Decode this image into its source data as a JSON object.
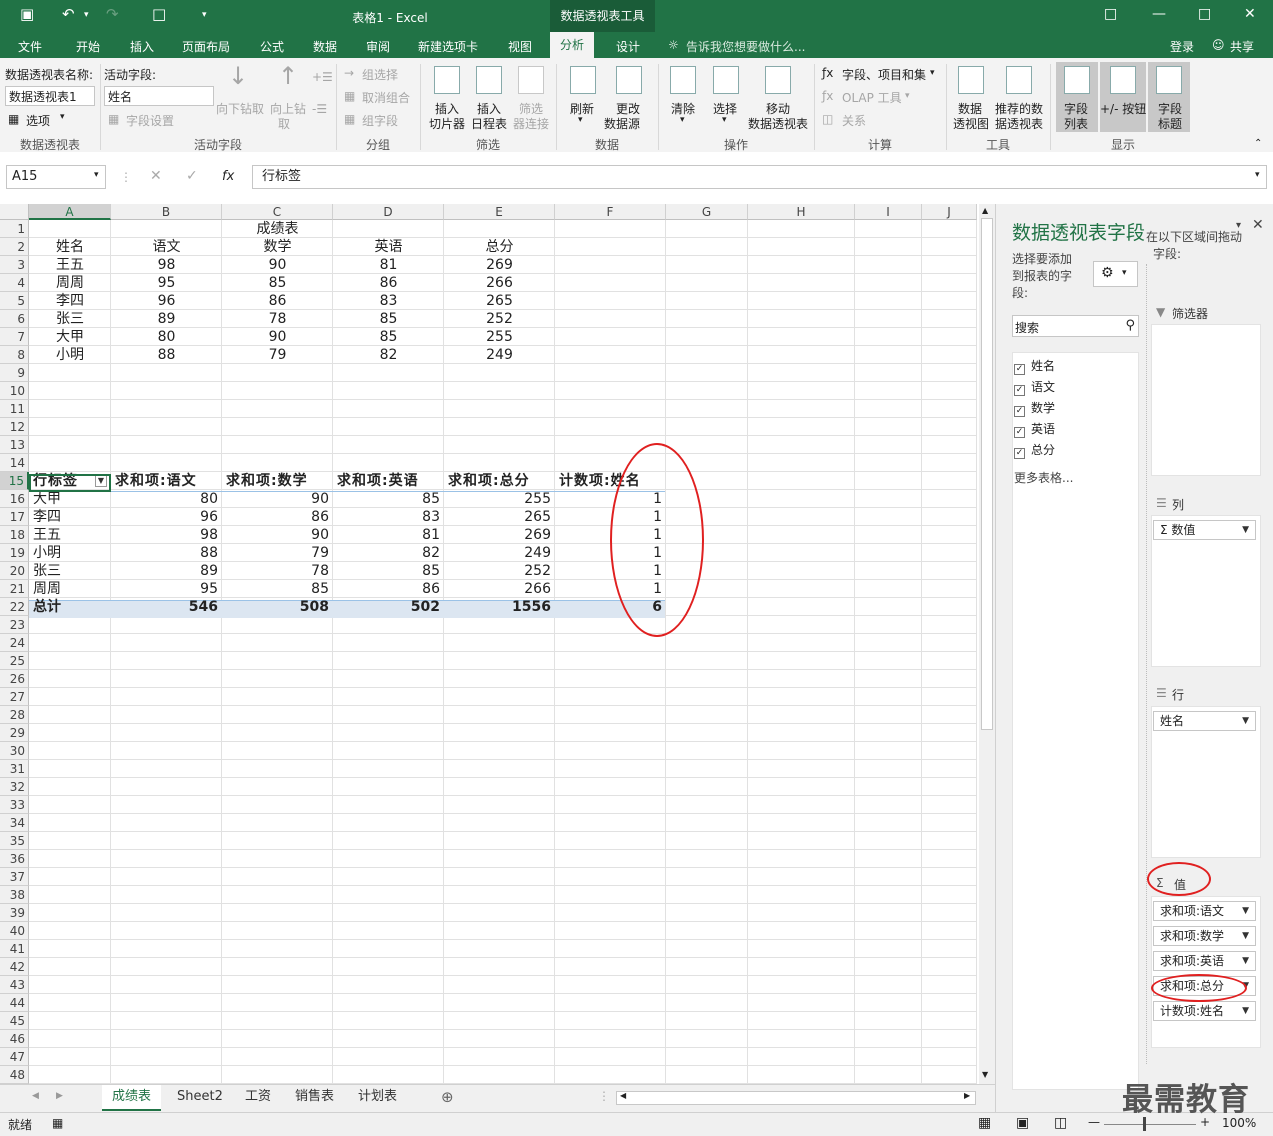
{
  "window": {
    "title": "表格1 - Excel",
    "context_tab": "数据透视表工具",
    "login": "登录",
    "share": "共享",
    "tell_me": "告诉我您想要做什么..."
  },
  "tabs": [
    "文件",
    "开始",
    "插入",
    "页面布局",
    "公式",
    "数据",
    "审阅",
    "新建选项卡",
    "视图",
    "分析",
    "设计"
  ],
  "active_tab": "分析",
  "ribbon": {
    "pt_name_label": "数据透视表名称:",
    "pt_name_value": "数据透视表1",
    "options": "选项",
    "group_pivot": "数据透视表",
    "active_field_label": "活动字段:",
    "active_field_value": "姓名",
    "field_settings": "字段设置",
    "drill_down": "向下钻取",
    "drill_up_1": "向上钻",
    "drill_up_2": "取",
    "group_active": "活动字段",
    "group_selection": "组选择",
    "ungroup": "取消组合",
    "group_field": "组字段",
    "group_group": "分组",
    "insert_slicer_1": "插入",
    "insert_slicer_2": "切片器",
    "insert_timeline_1": "插入",
    "insert_timeline_2": "日程表",
    "filter_conn_1": "筛选",
    "filter_conn_2": "器连接",
    "group_filter": "筛选",
    "refresh": "刷新",
    "change_src_1": "更改",
    "change_src_2": "数据源",
    "group_data": "数据",
    "clear": "清除",
    "select": "选择",
    "move_1": "移动",
    "move_2": "数据透视表",
    "group_actions": "操作",
    "fields_items": "字段、项目和集",
    "olap": "OLAP 工具",
    "relations": "关系",
    "group_calc": "计算",
    "pivot_chart_1": "数据",
    "pivot_chart_2": "透视图",
    "recommended_1": "推荐的数",
    "recommended_2": "据透视表",
    "group_tools": "工具",
    "field_list_1": "字段",
    "field_list_2": "列表",
    "buttons": "+/- 按钮",
    "field_headers_1": "字段",
    "field_headers_2": "标题",
    "group_show": "显示"
  },
  "formula_bar": {
    "name_box": "A15",
    "formula": "行标签"
  },
  "columns": [
    "A",
    "B",
    "C",
    "D",
    "E",
    "F",
    "G",
    "H",
    "I",
    "J"
  ],
  "rows": [
    "1",
    "2",
    "3",
    "4",
    "5",
    "6",
    "7",
    "8",
    "9",
    "10",
    "11",
    "12",
    "13",
    "14",
    "15",
    "16",
    "17",
    "18",
    "19",
    "20",
    "21",
    "22",
    "23",
    "24",
    "25",
    "26",
    "27",
    "28",
    "29",
    "30",
    "31",
    "32",
    "33",
    "34",
    "35",
    "36",
    "37",
    "38",
    "39",
    "40",
    "41",
    "42",
    "43",
    "44",
    "45",
    "46",
    "47",
    "48"
  ],
  "source_table": {
    "title": "成绩表",
    "headers": [
      "姓名",
      "语文",
      "数学",
      "英语",
      "总分"
    ],
    "rows": [
      [
        "王五",
        "98",
        "90",
        "81",
        "269"
      ],
      [
        "周周",
        "95",
        "85",
        "86",
        "266"
      ],
      [
        "李四",
        "96",
        "86",
        "83",
        "265"
      ],
      [
        "张三",
        "89",
        "78",
        "85",
        "252"
      ],
      [
        "大甲",
        "80",
        "90",
        "85",
        "255"
      ],
      [
        "小明",
        "88",
        "79",
        "82",
        "249"
      ]
    ]
  },
  "pivot": {
    "headers": [
      "行标签",
      "求和项:语文",
      "求和项:数学",
      "求和项:英语",
      "求和项:总分",
      "计数项:姓名"
    ],
    "rows": [
      [
        "大甲",
        "80",
        "90",
        "85",
        "255",
        "1"
      ],
      [
        "李四",
        "96",
        "86",
        "83",
        "265",
        "1"
      ],
      [
        "王五",
        "98",
        "90",
        "81",
        "269",
        "1"
      ],
      [
        "小明",
        "88",
        "79",
        "82",
        "249",
        "1"
      ],
      [
        "张三",
        "89",
        "78",
        "85",
        "252",
        "1"
      ],
      [
        "周周",
        "95",
        "85",
        "86",
        "266",
        "1"
      ]
    ],
    "total": [
      "总计",
      "546",
      "508",
      "502",
      "1556",
      "6"
    ]
  },
  "sheets": [
    "成绩表",
    "Sheet2",
    "工资",
    "销售表",
    "计划表"
  ],
  "active_sheet": "成绩表",
  "status": {
    "ready": "就绪",
    "zoom": "100%"
  },
  "field_pane": {
    "title": "数据透视表字段",
    "choose_1": "选择要添加",
    "choose_2": "到报表的字",
    "choose_3": "段:",
    "drag_1": "在以下区域间拖动",
    "drag_2": "字段:",
    "search_placeholder": "搜索",
    "fields": [
      "姓名",
      "语文",
      "数学",
      "英语",
      "总分"
    ],
    "more_tables": "更多表格...",
    "filters_label": "筛选器",
    "columns_label": "列",
    "columns_items": [
      "Σ 数值"
    ],
    "rows_label": "行",
    "rows_items": [
      "姓名"
    ],
    "values_label": "值",
    "values_items": [
      "求和项:语文",
      "求和项:数学",
      "求和项:英语",
      "求和项:总分",
      "计数项:姓名"
    ]
  },
  "watermark": "最需教育"
}
